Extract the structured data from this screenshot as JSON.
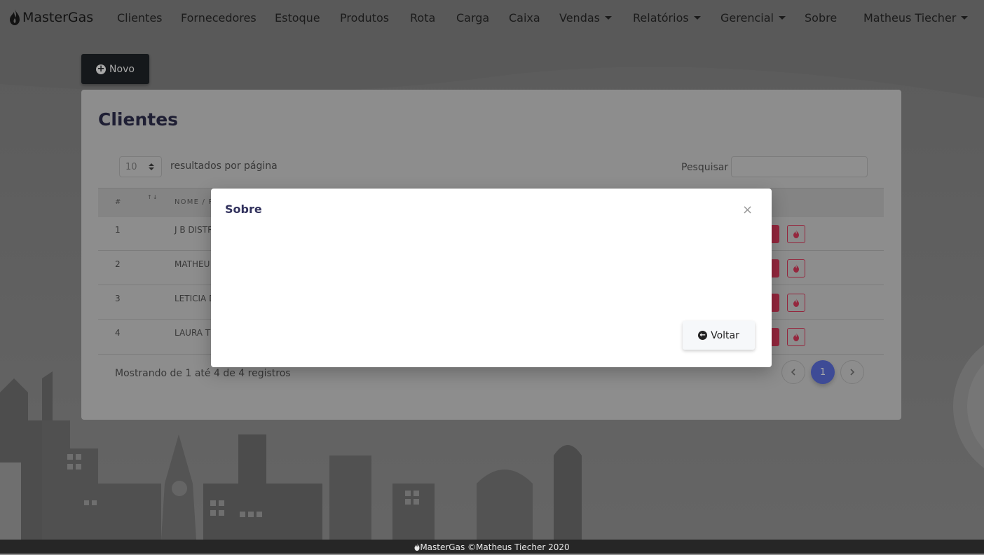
{
  "navbar": {
    "brand": "MasterGas",
    "items": [
      {
        "label": "Clientes"
      },
      {
        "label": "Fornecedores"
      },
      {
        "label": "Estoque"
      },
      {
        "label": "Produtos"
      },
      {
        "label": "Rota"
      },
      {
        "label": "Carga"
      },
      {
        "label": "Caixa"
      },
      {
        "label": "Vendas",
        "dropdown": true
      },
      {
        "label": "Relatórios",
        "dropdown": true
      },
      {
        "label": "Gerencial",
        "dropdown": true
      },
      {
        "label": "Sobre"
      }
    ],
    "user": "Matheus Tiecher"
  },
  "novo_button": {
    "label": "Novo",
    "icon": "plus-circle-icon"
  },
  "card": {
    "title": "Clientes",
    "page_length": "10",
    "page_length_label": "resultados por página",
    "search_label": "Pesquisar",
    "search_value": "",
    "columns": [
      "#",
      "Nome / R"
    ],
    "rows": [
      {
        "id": "1",
        "name": "J B DISTR"
      },
      {
        "id": "2",
        "name": "MATHEU"
      },
      {
        "id": "3",
        "name": "LETICIA D"
      },
      {
        "id": "4",
        "name": "LAURA T"
      }
    ],
    "info": "Mostrando de 1 até 4 de 4 registros",
    "pagination": {
      "current": "1"
    }
  },
  "modal": {
    "title": "Sobre",
    "close_symbol": "×",
    "back_button": "Voltar"
  },
  "footer": {
    "text": "MasterGas ©Matheus Tiecher 2020"
  },
  "colors": {
    "navbar_text": "#2a2a2a",
    "dark_button": "#212529",
    "danger": "#e23c5e",
    "primary": "#5e72e4",
    "footer_bg": "#262626"
  }
}
